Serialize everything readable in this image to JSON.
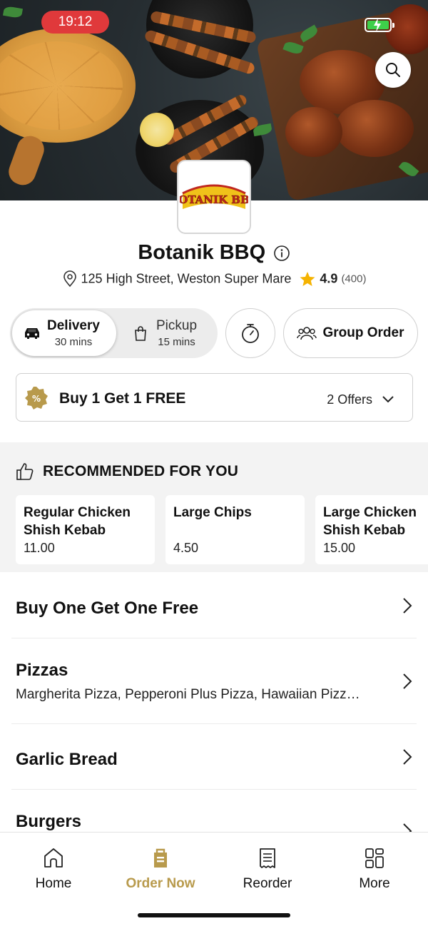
{
  "status_bar": {
    "time": "19:12"
  },
  "colors": {
    "accent": "#b89a4c",
    "time_pill": "#e0393b",
    "star": "#f5b301",
    "battery": "#3ecf4a"
  },
  "restaurant": {
    "logo_text": "BOTANIK BBQ",
    "name": "Botanik BBQ",
    "address": "125 High Street, Weston Super Mare",
    "rating": "4.9",
    "rating_count": "(400)"
  },
  "order_type": {
    "delivery": {
      "label": "Delivery",
      "time": "30 mins"
    },
    "pickup": {
      "label": "Pickup",
      "time": "15 mins"
    },
    "group_order_label": "Group Order"
  },
  "offer": {
    "title": "Buy 1 Get 1 FREE",
    "count_label": "2 Offers"
  },
  "recommended": {
    "heading": "RECOMMENDED FOR YOU",
    "items": [
      {
        "name": "Regular Chicken Shish Kebab",
        "price": "11.00"
      },
      {
        "name": "Large Chips",
        "price": "4.50"
      },
      {
        "name": "Large Chicken Shish Kebab",
        "price": "15.00"
      }
    ]
  },
  "menu": [
    {
      "title": "Buy One Get One Free",
      "desc": ""
    },
    {
      "title": "Pizzas",
      "desc": "Margherita Pizza, Pepperoni Plus Pizza, Hawaiian Pizz…"
    },
    {
      "title": "Garlic Bread",
      "desc": ""
    },
    {
      "title": "Burgers",
      "desc": ""
    }
  ],
  "tabs": [
    {
      "label": "Home",
      "icon": "home-icon"
    },
    {
      "label": "Order Now",
      "icon": "order-bag-icon"
    },
    {
      "label": "Reorder",
      "icon": "receipt-icon"
    },
    {
      "label": "More",
      "icon": "grid-icon"
    }
  ]
}
